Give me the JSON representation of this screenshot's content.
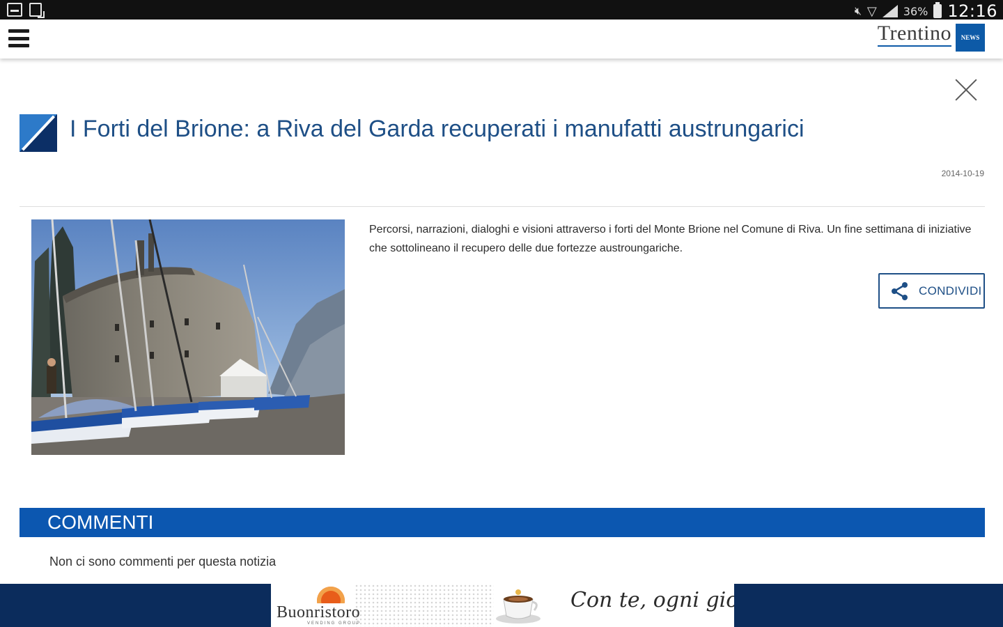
{
  "status_bar": {
    "battery_percent": "36%",
    "time": "12:16"
  },
  "app_bar": {
    "brand_name": "Trentino",
    "brand_badge": "NEWS"
  },
  "article": {
    "title": "I Forti del Brione: a Riva del Garda recuperati i manufatti austrungarici",
    "date": "2014-10-19",
    "lead": "Percorsi, narrazioni, dialoghi e visioni attraverso i forti del Monte Brione nel Comune di Riva. Un fine settimana di iniziative che sottolineano il recupero delle due fortezze austroungariche.",
    "share_label": "CONDIVIDI"
  },
  "comments": {
    "title": "COMMENTI",
    "empty_text": "Non ci sono commenti per questa notizia"
  },
  "ad": {
    "brand": "Buonristoro",
    "brand_sub": "VENDING GROUP",
    "slogan": "Con te, ogni giorno"
  },
  "colors": {
    "brand_blue": "#1e4f86",
    "comments_bar": "#0c57b0",
    "ad_background": "#0b2c5c"
  }
}
